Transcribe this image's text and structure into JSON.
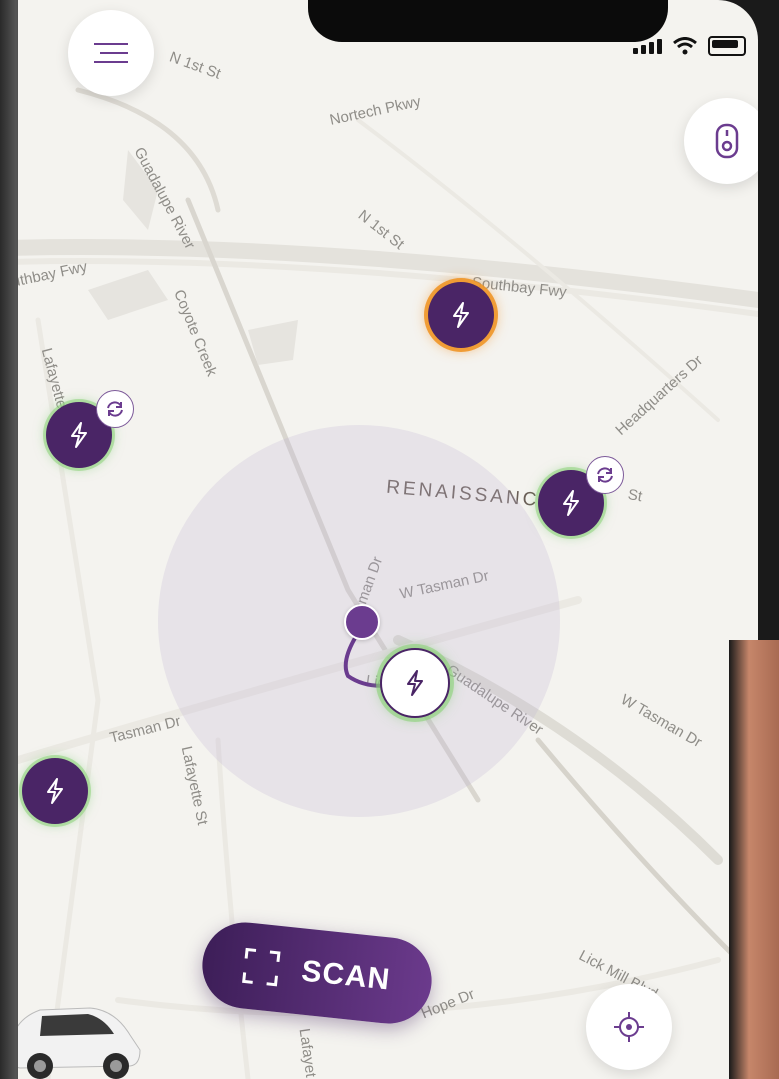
{
  "streets": {
    "n_1st_st_top": "N 1st St",
    "nortech_pkwy": "Nortech Pkwy",
    "guadalupe_river_top": "Guadalupe River",
    "n_1st_st_mid": "N 1st St",
    "southbay_fwy_left": "uthbay Fwy",
    "southbay_fwy_right": "Southbay Fwy",
    "coyote_creek": "Coyote Creek",
    "lafayette_top": "Lafayette",
    "headquarters_dr": "Headquarters Dr",
    "st_right": "St",
    "w_tasman_dr_center": "W Tasman Dr",
    "lick_left": "Lick",
    "guadalupe_river_bottom": "Guadalupe River",
    "w_tasman_dr_right": "W Tasman Dr",
    "tasman_dr": "Tasman Dr",
    "lafayette_st": "Lafayette St",
    "lick_mill_blvd": "Lick Mill Blvd",
    "hope_dr": "Hope Dr",
    "lafayette_bottom": "Lafayet",
    "tasman_partial": "asman Dr"
  },
  "district": "RENAISSANCE",
  "scan_button": {
    "label": "SCAN",
    "icon": "scan-frame-icon"
  },
  "icons": {
    "menu": "hamburger-menu-icon",
    "key": "key-fob-icon",
    "locate": "crosshair-locate-icon",
    "charger": "lightning-bolt-icon",
    "sync": "sync-icon"
  },
  "colors": {
    "brand_purple": "#4a2566",
    "accent_purple": "#6b3c8f",
    "available_glow": "#8cd278",
    "busy_glow": "#f09628",
    "map_bg": "#f4f3ef"
  }
}
